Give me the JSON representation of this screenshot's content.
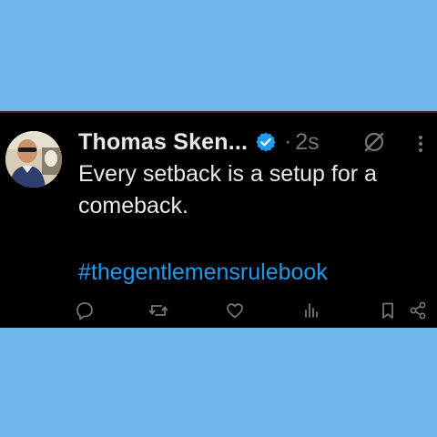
{
  "post": {
    "author_name": "Thomas Sken...",
    "separator": "·",
    "timestamp": "2s",
    "text": "Every setback is a setup for a comeback.",
    "hashtag": "#thegentlemensrulebook"
  },
  "icons": {
    "verified": "verified-badge-icon",
    "grok": "grok-icon",
    "more": "more-options-icon",
    "reply": "reply-icon",
    "repost": "repost-icon",
    "like": "like-icon",
    "views": "views-icon",
    "bookmark": "bookmark-icon",
    "share": "share-icon"
  },
  "colors": {
    "background": "#71b8ec",
    "card": "#000000",
    "text": "#e7e9ea",
    "muted": "#71767b",
    "accent": "#1d9bf0"
  }
}
